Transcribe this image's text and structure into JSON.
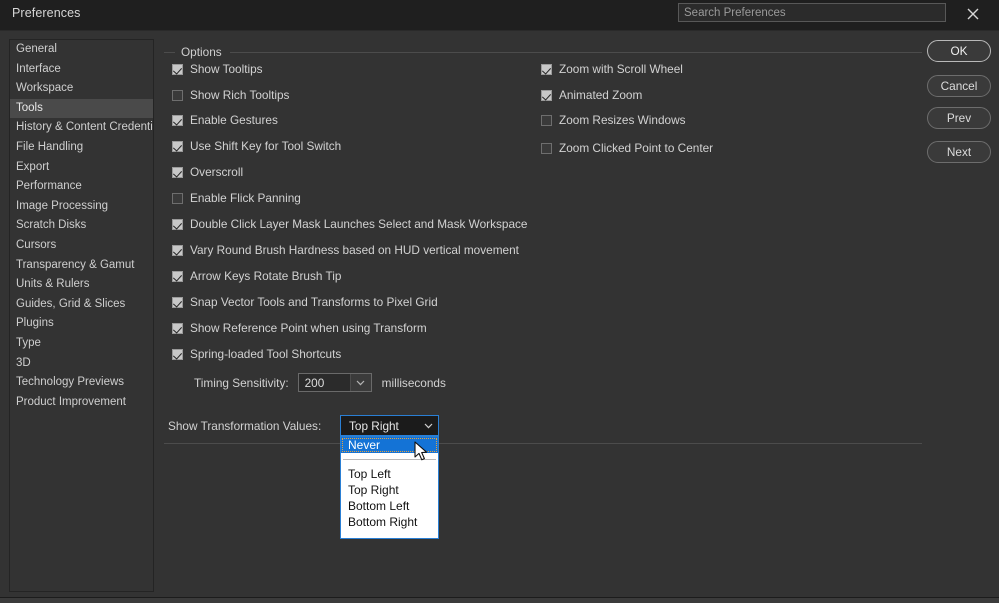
{
  "window": {
    "title": "Preferences",
    "close_icon": "close-icon"
  },
  "search": {
    "placeholder": "Search Preferences",
    "value": ""
  },
  "sidebar": {
    "items": [
      {
        "label": "General",
        "selected": false
      },
      {
        "label": "Interface",
        "selected": false
      },
      {
        "label": "Workspace",
        "selected": false
      },
      {
        "label": "Tools",
        "selected": true
      },
      {
        "label": "History & Content Credentials",
        "selected": false
      },
      {
        "label": "File Handling",
        "selected": false
      },
      {
        "label": "Export",
        "selected": false
      },
      {
        "label": "Performance",
        "selected": false
      },
      {
        "label": "Image Processing",
        "selected": false
      },
      {
        "label": "Scratch Disks",
        "selected": false
      },
      {
        "label": "Cursors",
        "selected": false
      },
      {
        "label": "Transparency & Gamut",
        "selected": false
      },
      {
        "label": "Units & Rulers",
        "selected": false
      },
      {
        "label": "Guides, Grid & Slices",
        "selected": false
      },
      {
        "label": "Plugins",
        "selected": false
      },
      {
        "label": "Type",
        "selected": false
      },
      {
        "label": "3D",
        "selected": false
      },
      {
        "label": "Technology Previews",
        "selected": false
      },
      {
        "label": "Product Improvement",
        "selected": false
      }
    ]
  },
  "options_group": {
    "legend": "Options",
    "left_column": [
      {
        "label": "Show Tooltips",
        "checked": true
      },
      {
        "label": "Show Rich Tooltips",
        "checked": false
      },
      {
        "label": "Enable Gestures",
        "checked": true
      },
      {
        "label": "Use Shift Key for Tool Switch",
        "checked": true
      },
      {
        "label": "Overscroll",
        "checked": true
      },
      {
        "label": "Enable Flick Panning",
        "checked": false
      },
      {
        "label": "Double Click Layer Mask Launches Select and Mask Workspace",
        "checked": true
      },
      {
        "label": "Vary Round Brush Hardness based on HUD vertical movement",
        "checked": true
      },
      {
        "label": "Arrow Keys Rotate Brush Tip",
        "checked": true
      },
      {
        "label": "Snap Vector Tools and Transforms to Pixel Grid",
        "checked": true
      },
      {
        "label": "Show Reference Point when using Transform",
        "checked": true
      },
      {
        "label": "Spring-loaded Tool Shortcuts",
        "checked": true
      }
    ],
    "right_column": [
      {
        "label": "Zoom with Scroll Wheel",
        "checked": true
      },
      {
        "label": "Animated Zoom",
        "checked": true
      },
      {
        "label": "Zoom Resizes Windows",
        "checked": false
      },
      {
        "label": "Zoom Clicked Point to Center",
        "checked": false
      }
    ],
    "timing": {
      "label": "Timing Sensitivity:",
      "value": "200",
      "units": "milliseconds"
    },
    "transformation_values": {
      "label": "Show Transformation Values:",
      "selected": "Top Right",
      "open": true,
      "options": [
        {
          "label": "Never",
          "highlighted": true
        },
        {
          "label": "Top Left",
          "highlighted": false
        },
        {
          "label": "Top Right",
          "highlighted": false
        },
        {
          "label": "Bottom Left",
          "highlighted": false
        },
        {
          "label": "Bottom Right",
          "highlighted": false
        }
      ]
    }
  },
  "buttons": {
    "ok": "OK",
    "cancel": "Cancel",
    "prev": "Prev",
    "next": "Next"
  },
  "colors": {
    "dialog_bg": "#333333",
    "titlebar_bg": "#1f1f1f",
    "accent_blue": "#1473d6",
    "focus_border": "#2a7fd4",
    "focus_outline": "#e8a33d",
    "selected_item_bg": "#4a4a4a"
  }
}
